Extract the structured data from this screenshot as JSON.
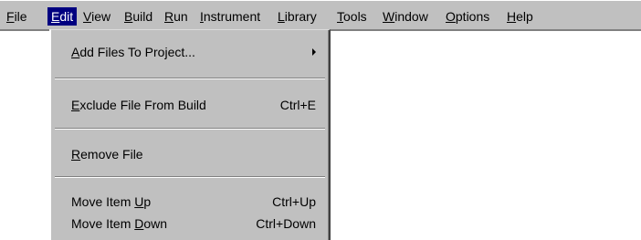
{
  "menubar": {
    "items": [
      {
        "pre": "",
        "acc": "F",
        "post": "ile"
      },
      {
        "pre": "",
        "acc": "E",
        "post": "dit"
      },
      {
        "pre": "",
        "acc": "V",
        "post": "iew"
      },
      {
        "pre": "",
        "acc": "B",
        "post": "uild"
      },
      {
        "pre": "",
        "acc": "R",
        "post": "un"
      },
      {
        "pre": "",
        "acc": "I",
        "post": "nstrument"
      },
      {
        "pre": "",
        "acc": "L",
        "post": "ibrary"
      },
      {
        "pre": "",
        "acc": "T",
        "post": "ools"
      },
      {
        "pre": "",
        "acc": "W",
        "post": "indow"
      },
      {
        "pre": "",
        "acc": "O",
        "post": "ptions"
      },
      {
        "pre": "",
        "acc": "H",
        "post": "elp"
      }
    ]
  },
  "edit_menu": {
    "add_files": {
      "pre": "",
      "acc": "A",
      "post": "dd Files To Project..."
    },
    "exclude_file": {
      "pre": "",
      "acc": "E",
      "post": "xclude File From Build",
      "shortcut": "Ctrl+E"
    },
    "remove_file": {
      "pre": "",
      "acc": "R",
      "post": "emove File"
    },
    "move_up": {
      "pre": "Move Item ",
      "acc": "U",
      "post": "p",
      "shortcut": "Ctrl+Up"
    },
    "move_down": {
      "pre": "Move Item ",
      "acc": "D",
      "post": "own",
      "shortcut": "Ctrl+Down"
    }
  },
  "colors": {
    "menu_face": "#c0c0c0",
    "highlight": "#000080",
    "highlight_text": "#ffffff"
  },
  "icons": {
    "submenu": "submenu-arrow-icon"
  }
}
